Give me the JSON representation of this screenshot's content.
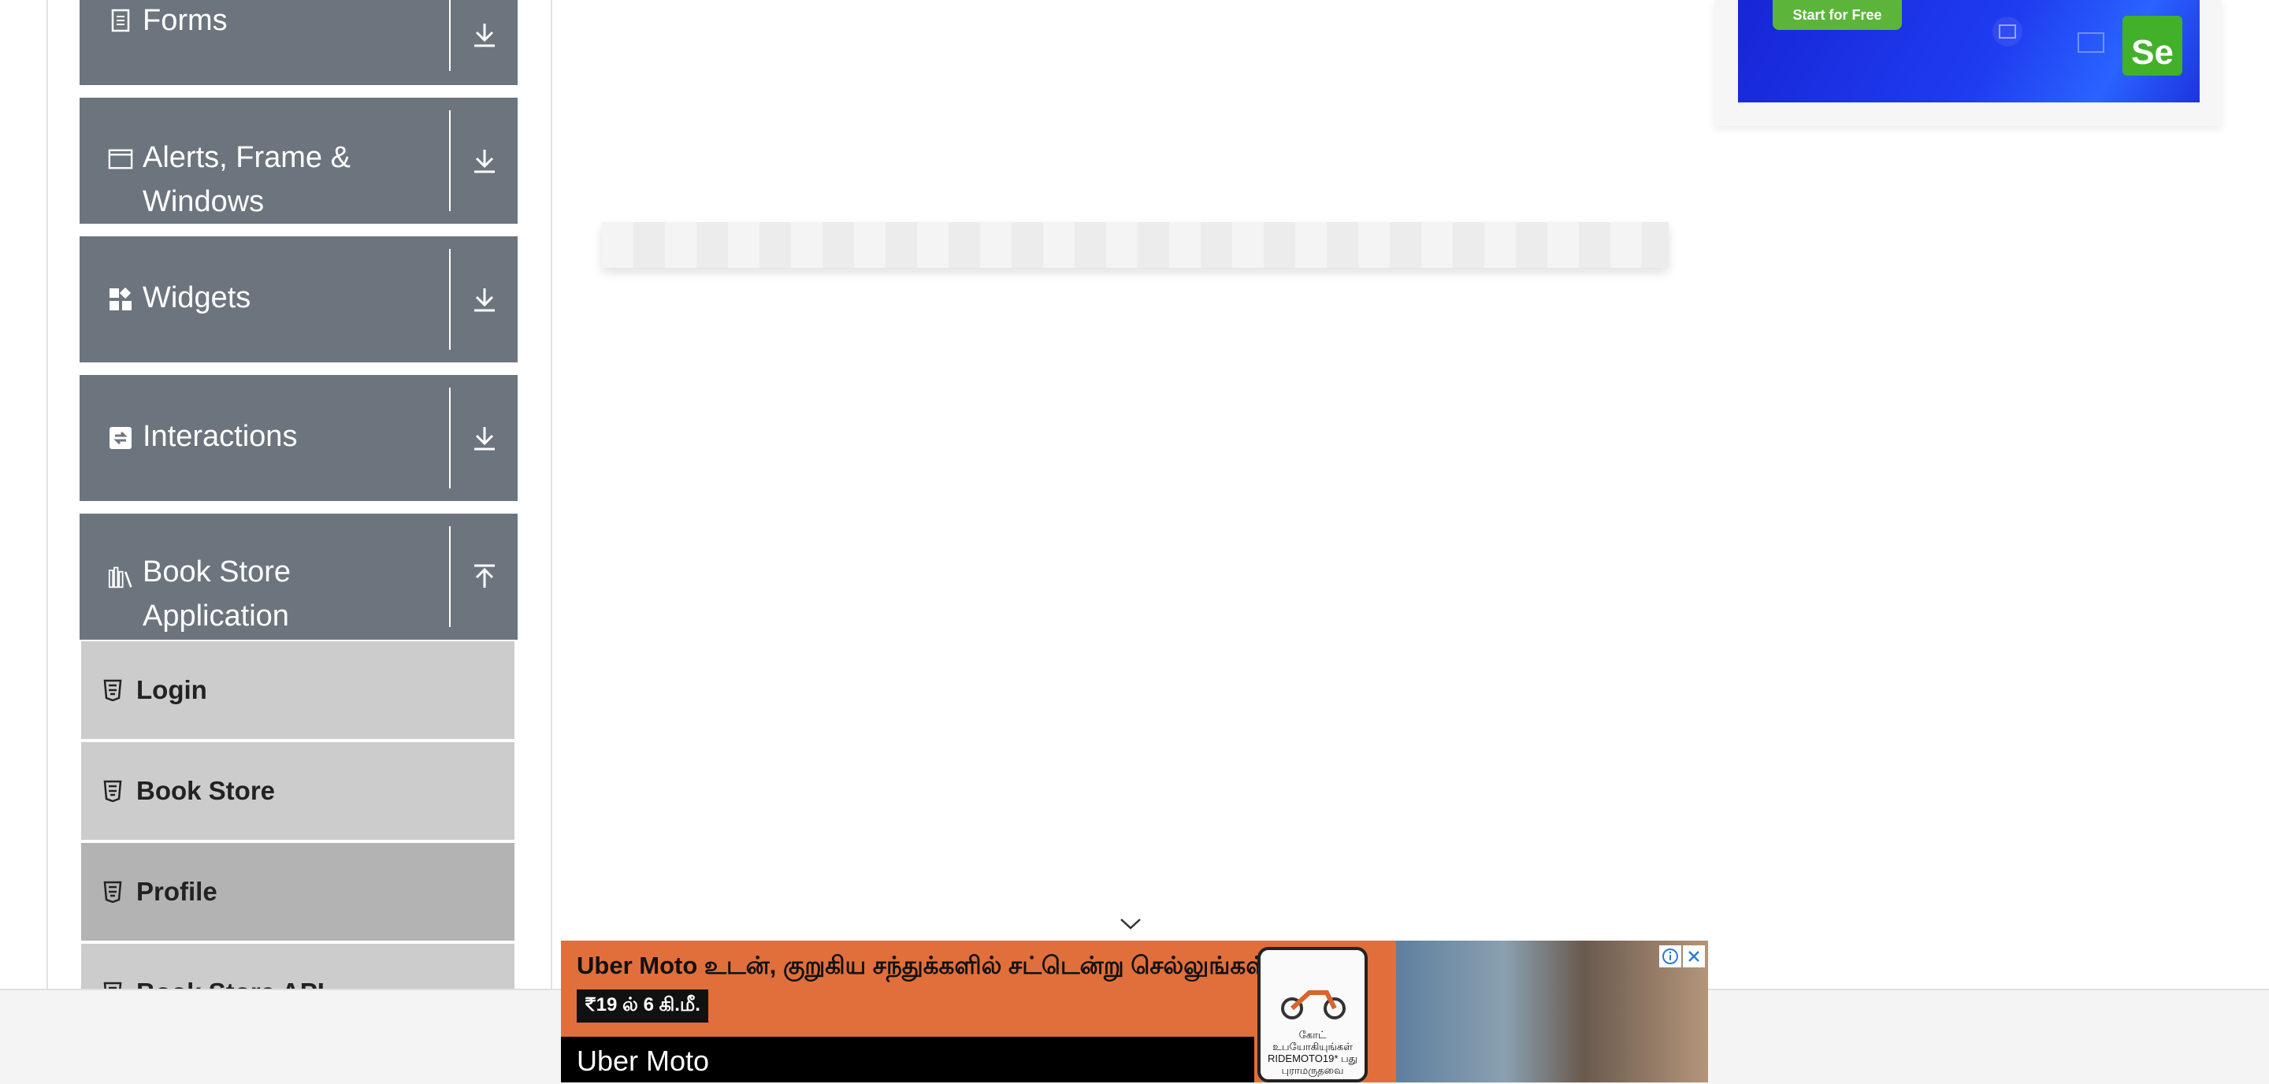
{
  "sidebar": {
    "groups": [
      {
        "label": "Forms",
        "icon": "document-icon",
        "toggle_icon": "download-arrow-icon"
      },
      {
        "label": "Alerts, Frame & Windows",
        "icon": "window-icon",
        "toggle_icon": "download-arrow-icon"
      },
      {
        "label": "Widgets",
        "icon": "widgets-icon",
        "toggle_icon": "download-arrow-icon"
      },
      {
        "label": "Interactions",
        "icon": "interactions-icon",
        "toggle_icon": "download-arrow-icon"
      },
      {
        "label": "Book Store Application",
        "icon": "books-icon",
        "toggle_icon": "upload-arrow-icon"
      }
    ],
    "book_store_items": [
      {
        "label": "Login",
        "icon": "html5-icon"
      },
      {
        "label": "Book Store",
        "icon": "html5-icon"
      },
      {
        "label": "Profile",
        "icon": "html5-icon",
        "active": true
      },
      {
        "label": "Book Store API",
        "icon": "html5-icon"
      }
    ]
  },
  "top_ad": {
    "cta": "Start for Free",
    "logo_text": "Se",
    "accent": "#5cb53a"
  },
  "bottom_ad": {
    "headline": "Uber Moto உடன், குறுகிய சந்துக்களில் சட்டென்று செல்லுங்கள்.",
    "price": "₹19 ல் 6 கி.மீ.",
    "brand": "Uber Moto",
    "phone_text": "கோட் உபயோகியுங்கள் RIDEMOTO19* பது புராமருதவை",
    "background": "#e06f3b"
  },
  "colors": {
    "group_bg": "#6c757d",
    "sub_bg": "#cccccc",
    "sub_active_bg": "#b3b3b3"
  }
}
